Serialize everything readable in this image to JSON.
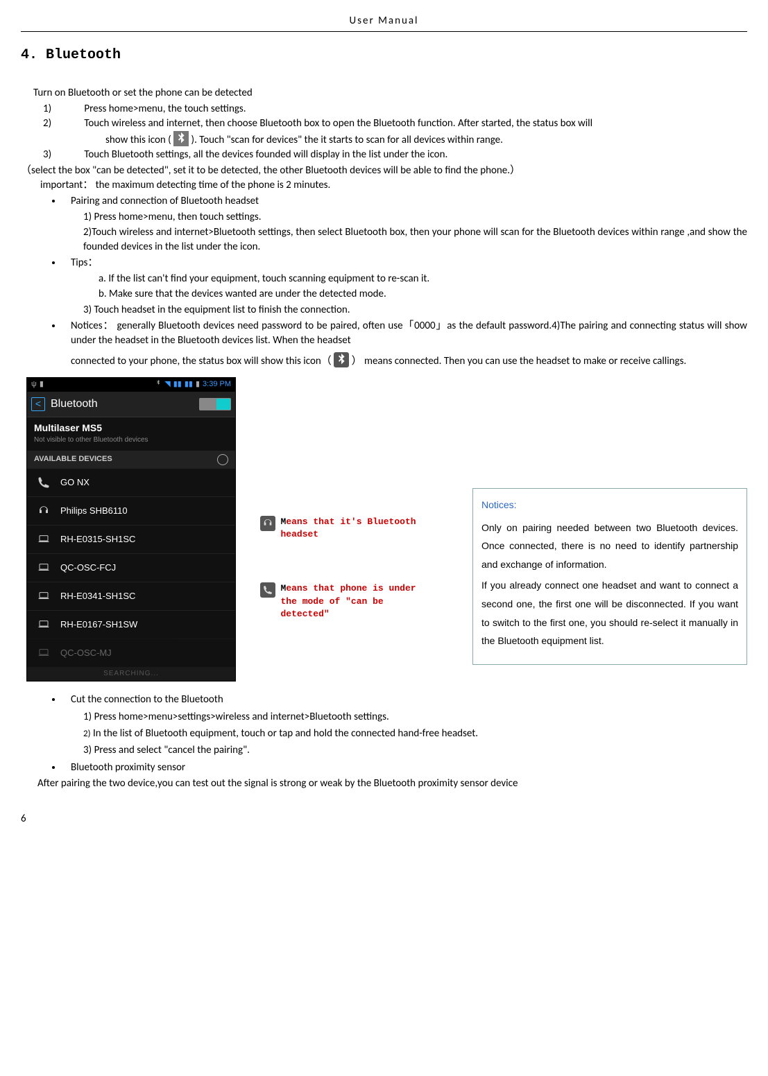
{
  "header": {
    "title": "User    Manual"
  },
  "section": {
    "title": "4. Bluetooth"
  },
  "intro": "Turn on Bluetooth or set the phone can be detected",
  "steps": {
    "s1": {
      "n": "1)",
      "t": "Press home>menu, the touch settings."
    },
    "s2": {
      "n": "2)",
      "t_a": "Touch wireless and internet, then choose Bluetooth box to open the Bluetooth function. After started, the status box will",
      "t_b": "show this icon (",
      "t_c": "). Touch   \"scan for devices\" the it starts to scan for all devices within range."
    },
    "s3": {
      "n": "3)",
      "t": "Touch Bluetooth settings, all the devices founded will display in the list under the icon."
    }
  },
  "select_line": "（select the box \"can be detected\", set it to be detected, the other Bluetooth devices will be able to find the phone.）",
  "important": "important： the maximum detecting time of the phone is 2 minutes.",
  "bullet1": {
    "title": "Pairing and connection of Bluetooth headset",
    "p1": "1) Press home>menu, then touch settings.",
    "p2": "2)Touch wireless and internet>Bluetooth settings, then select Bluetooth box, then your phone will scan for the Bluetooth devices within range ,and show the founded devices in the list under the icon."
  },
  "tips": {
    "title": "Tips：",
    "a": "a.  If the list can't find your equipment, touch scanning equipment to re-scan it.",
    "b": "b.  Make sure that the devices wanted are under the detected mode.",
    "p3": "3) Touch headset in the equipment list to finish the connection."
  },
  "notices": {
    "label": "Notices：",
    "text_a": "generally Bluetooth devices need password to be paired, often use「0000」as the default password.4)The pairing and connecting status will show under the headset in the Bluetooth devices list. When the headset",
    "text_b1": "connected to your phone, the status box will show this icon（",
    "text_b2": "） means connected. Then you can use the headset to make or receive callings."
  },
  "phone": {
    "time": "3:39 PM",
    "title": "Bluetooth",
    "self_name": "Multilaser MS5",
    "self_vis": "Not visible to other Bluetooth devices",
    "section_label": "AVAILABLE DEVICES",
    "devices": [
      {
        "icon": "phone",
        "name": "GO NX"
      },
      {
        "icon": "headset",
        "name": "Philips SHB6110"
      },
      {
        "icon": "laptop",
        "name": "RH-E0315-SH1SC"
      },
      {
        "icon": "laptop",
        "name": "QC-OSC-FCJ"
      },
      {
        "icon": "laptop",
        "name": "RH-E0341-SH1SC"
      },
      {
        "icon": "laptop",
        "name": "RH-E0167-SH1SW"
      },
      {
        "icon": "laptop",
        "name": "QC-OSC-MJ"
      }
    ],
    "searching": "SEARCHING..."
  },
  "callouts": {
    "c1": "Means that it's Bluetooth headset",
    "c2_a": "Means that phone is under",
    "c2_b": "the mode of \"can be",
    "c2_c": "detected\""
  },
  "notice_box": {
    "title": "Notices:",
    "p1": "Only on pairing needed between two Bluetooth devices. Once connected, there is no need to identify partnership and exchange of information.",
    "p2": "If you already connect one headset and want to connect a second one, the first one will be disconnected. If you want to switch to the first one, you should re-select it manually in the Bluetooth equipment list."
  },
  "cut": {
    "title": "Cut the connection to the Bluetooth",
    "s1": {
      "n": "1)",
      "t": "Press home>menu>settings>wireless and internet>Bluetooth settings."
    },
    "s2": {
      "n": "2)",
      "t": "In the list of Bluetooth equipment, touch or tap and hold the connected hand-free headset."
    },
    "s3": {
      "n": "3)",
      "t": "Press and select \"cancel the pairing\"."
    }
  },
  "proximity": {
    "title": "Bluetooth proximity sensor",
    "text": "After pairing the two device,you can test out the signal is strong or weak by the Bluetooth proximity sensor device"
  },
  "page_num": "6"
}
